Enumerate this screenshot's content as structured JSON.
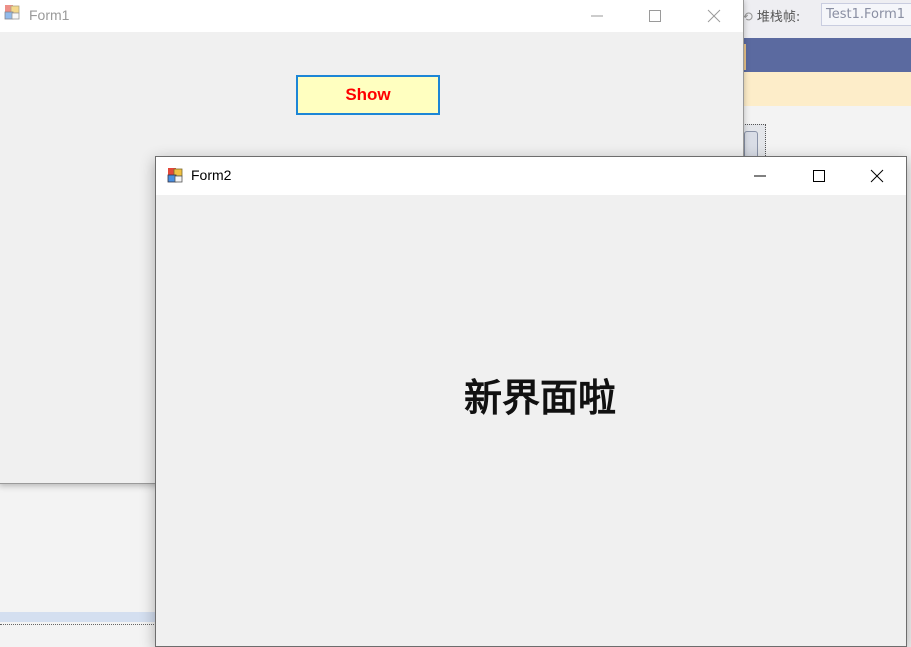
{
  "ide": {
    "stack_frame_label": "堆栈帧:",
    "stack_frame_value": "Test1.Form1"
  },
  "form1": {
    "title": "Form1",
    "show_button_label": "Show",
    "colors": {
      "button_text": "#ff0000",
      "button_bg": "#ffffc0",
      "button_border": "#1d86d6"
    }
  },
  "form2": {
    "title": "Form2",
    "label_text": "新界面啦"
  },
  "icons": [
    "app-icon",
    "minimize-icon",
    "maximize-icon",
    "close-icon"
  ]
}
